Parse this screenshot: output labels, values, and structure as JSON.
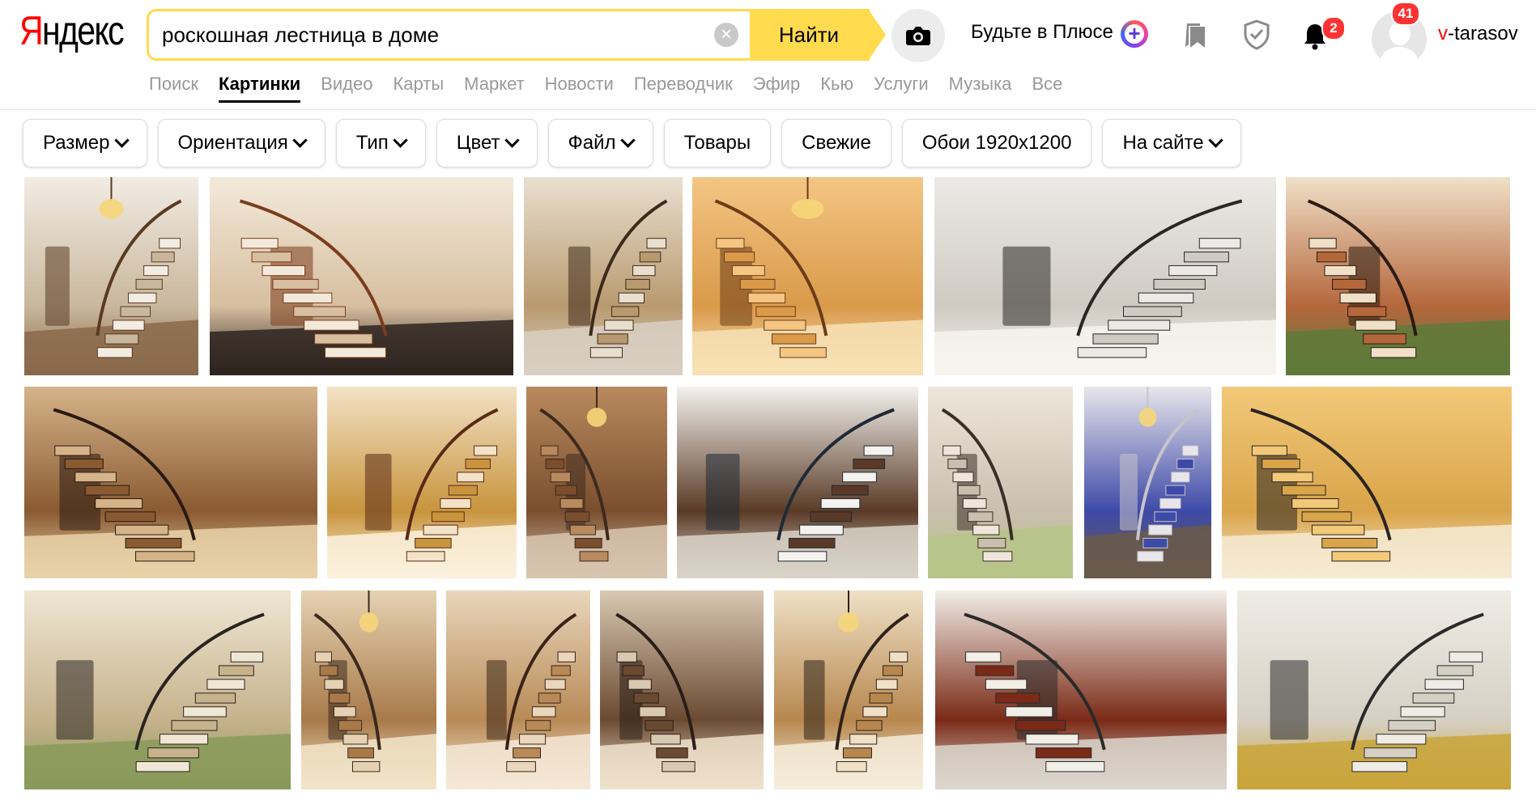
{
  "logo": {
    "first": "Я",
    "rest": "ндекс"
  },
  "search": {
    "query": "роскошная лестница в доме",
    "clear_label": "×",
    "find_label": "Найти"
  },
  "header": {
    "plus_text": "Будьте в Плюсе",
    "notifications_count": "2",
    "avatar_count": "41",
    "username_first": "v",
    "username_rest": "-tarasov"
  },
  "nav": {
    "tabs": [
      {
        "label": "Поиск",
        "active": false
      },
      {
        "label": "Картинки",
        "active": true
      },
      {
        "label": "Видео",
        "active": false
      },
      {
        "label": "Карты",
        "active": false
      },
      {
        "label": "Маркет",
        "active": false
      },
      {
        "label": "Новости",
        "active": false
      },
      {
        "label": "Переводчик",
        "active": false
      },
      {
        "label": "Эфир",
        "active": false
      },
      {
        "label": "Кью",
        "active": false
      },
      {
        "label": "Услуги",
        "active": false
      },
      {
        "label": "Музыка",
        "active": false
      },
      {
        "label": "Все",
        "active": false
      }
    ]
  },
  "filters": [
    {
      "label": "Размер",
      "dropdown": true
    },
    {
      "label": "Ориентация",
      "dropdown": true
    },
    {
      "label": "Тип",
      "dropdown": true
    },
    {
      "label": "Цвет",
      "dropdown": true
    },
    {
      "label": "Файл",
      "dropdown": true
    },
    {
      "label": "Товары",
      "dropdown": false
    },
    {
      "label": "Свежие",
      "dropdown": false
    },
    {
      "label": "Обои 1920х1200",
      "dropdown": false
    },
    {
      "label": "На сайте",
      "dropdown": true
    }
  ],
  "image_rows": [
    {
      "tiles": [
        {
          "palette": [
            "#f2ece3",
            "#c9b79d",
            "#5a3a22",
            "#8a6a4a"
          ]
        },
        {
          "palette": [
            "#f3e9da",
            "#d7bfa0",
            "#7a3d1c",
            "#2e2420"
          ]
        },
        {
          "palette": [
            "#e9dfcf",
            "#b99a70",
            "#3e2a1a",
            "#d8cfc2"
          ]
        },
        {
          "palette": [
            "#f4c583",
            "#d99a4a",
            "#6b3c16",
            "#f7e0b5"
          ]
        },
        {
          "palette": [
            "#eceae6",
            "#cfcac2",
            "#2a2624",
            "#f7f4ee"
          ]
        },
        {
          "palette": [
            "#f0e0c8",
            "#b5673c",
            "#2b1b12",
            "#5e7a3a"
          ]
        }
      ]
    },
    {
      "tiles": [
        {
          "palette": [
            "#d6b48a",
            "#8a5a32",
            "#2a1a10",
            "#e9d2a8"
          ]
        },
        {
          "palette": [
            "#f3e2c6",
            "#c8943d",
            "#5a2a16",
            "#fbf1dd"
          ]
        },
        {
          "palette": [
            "#b98a5e",
            "#7a4e2e",
            "#3e2a1e",
            "#d8c6b0"
          ]
        },
        {
          "palette": [
            "#f4f2ee",
            "#5a3a26",
            "#1e2a36",
            "#d9d3c8"
          ]
        },
        {
          "palette": [
            "#eee6da",
            "#c9bfae",
            "#3a2e26",
            "#b7c48a"
          ]
        },
        {
          "palette": [
            "#e8e6ea",
            "#3e4aa8",
            "#c8c4cc",
            "#6a5a4a"
          ]
        },
        {
          "palette": [
            "#f2c979",
            "#d9a44a",
            "#2a2420",
            "#f6ead2"
          ]
        }
      ]
    },
    {
      "tiles": [
        {
          "palette": [
            "#efe6d4",
            "#c7b28c",
            "#2a2420",
            "#8a9a5a"
          ]
        },
        {
          "palette": [
            "#e6d2b2",
            "#a87a4a",
            "#3a2a1e",
            "#f2e4c8"
          ]
        },
        {
          "palette": [
            "#e9d6bc",
            "#b88a56",
            "#3a2416",
            "#f4e8d6"
          ]
        },
        {
          "palette": [
            "#d9c8b2",
            "#6a4a32",
            "#2a1e16",
            "#efe2cc"
          ]
        },
        {
          "palette": [
            "#efe0c6",
            "#b7874e",
            "#2e2218",
            "#f6ecdb"
          ]
        },
        {
          "palette": [
            "#f2eee8",
            "#7a2a16",
            "#2a2a2a",
            "#dcd6cc"
          ]
        },
        {
          "palette": [
            "#efece6",
            "#d6d0c4",
            "#2a2a2a",
            "#c9a43a"
          ]
        }
      ]
    }
  ]
}
